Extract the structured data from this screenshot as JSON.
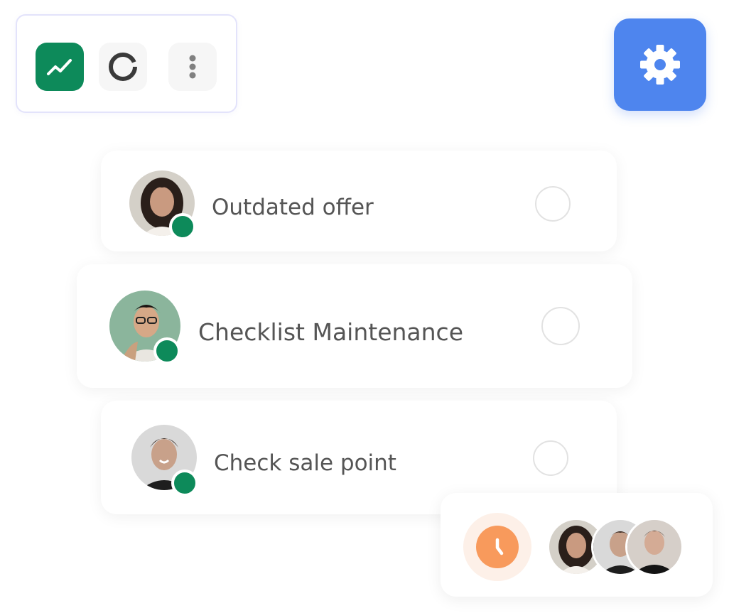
{
  "toolbar": {
    "buttons": [
      {
        "icon": "trend-chart-icon",
        "color": "#0d8a5a"
      },
      {
        "icon": "donut-chart-icon"
      },
      {
        "icon": "more-vertical-icon"
      }
    ]
  },
  "settings": {
    "icon": "gear-icon",
    "color": "#4e85ee"
  },
  "tasks": [
    {
      "title": "Outdated offer",
      "status_color": "#0d8a5a"
    },
    {
      "title": "Checklist Maintenance",
      "status_color": "#0d8a5a"
    },
    {
      "title": "Check sale point",
      "status_color": "#0d8a5a"
    }
  ],
  "footer": {
    "clock_icon": "clock-icon",
    "clock_color": "#f89a5c",
    "participants": 3
  }
}
